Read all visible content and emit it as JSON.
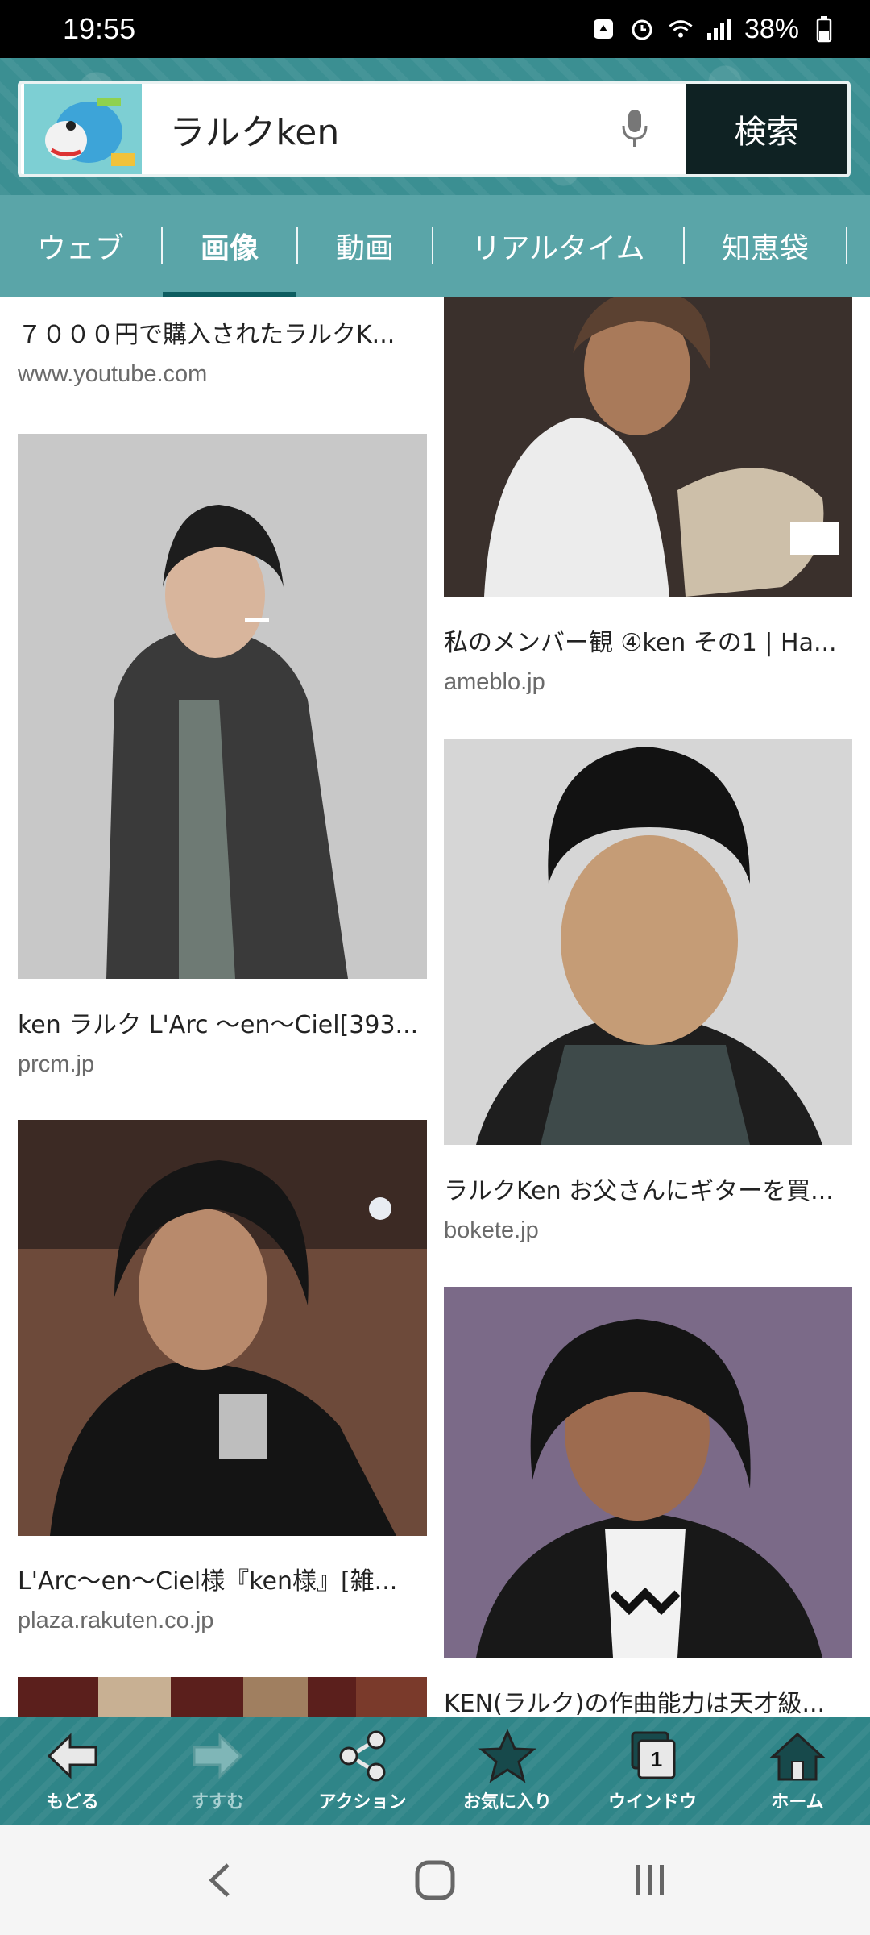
{
  "status": {
    "time": "19:55",
    "battery": "38%"
  },
  "search": {
    "query": "ラルクken",
    "button_label": "検索"
  },
  "tabs": [
    {
      "label": "ウェブ"
    },
    {
      "label": "画像"
    },
    {
      "label": "動画"
    },
    {
      "label": "リアルタイム"
    },
    {
      "label": "知恵袋"
    }
  ],
  "results": {
    "left": [
      {
        "title": "７０００円で購入されたラルクK...",
        "source": "www.youtube.com"
      },
      {
        "title": "ken ラルク L'Arc 〜en〜Ciel[393...",
        "source": "prcm.jp"
      },
      {
        "title": "L'Arc〜en〜Ciel様『ken様』[雑...",
        "source": "plaza.rakuten.co.jp"
      }
    ],
    "right": [
      {
        "title": "私のメンバー観 ④ken その1 | Ha...",
        "source": "ameblo.jp"
      },
      {
        "title": "ラルクKen お父さんにギターを買...",
        "source": "bokete.jp"
      },
      {
        "title": "KEN(ラルク)の作曲能力は天才級...",
        "source": ""
      }
    ]
  },
  "toolbar": {
    "back": "もどる",
    "forward": "すすむ",
    "action": "アクション",
    "favorites": "お気に入り",
    "window": "ウインドウ",
    "window_count": "1",
    "home": "ホーム"
  },
  "colors": {
    "header": "#3b8f92",
    "tabs": "#5aa5a8",
    "toolbar": "#2f8588",
    "search_button": "#0f2223"
  }
}
